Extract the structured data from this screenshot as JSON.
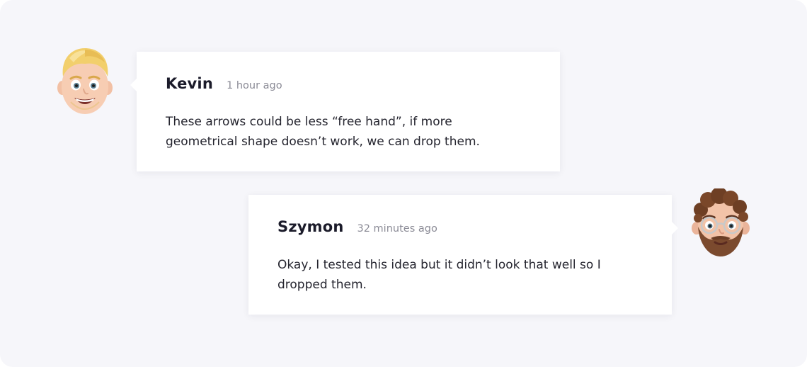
{
  "comments": [
    {
      "author": "Kevin",
      "time": "1 hour ago",
      "text": "These arrows could be less “free hand”, if more geometrical shape doesn’t work, we can drop them.",
      "avatar": "avatar-emoji-blond-smiling"
    },
    {
      "author": "Szymon",
      "time": "32 minutes ago",
      "text": "Okay, I tested this idea but it didn’t look that well so I dropped them.",
      "avatar": "avatar-emoji-bearded-glasses"
    }
  ],
  "colors": {
    "background": "#f6f6fa",
    "bubble": "#ffffff",
    "author_text": "#1b1b2a",
    "time_text": "#8b8b96",
    "message_text": "#25252f"
  }
}
